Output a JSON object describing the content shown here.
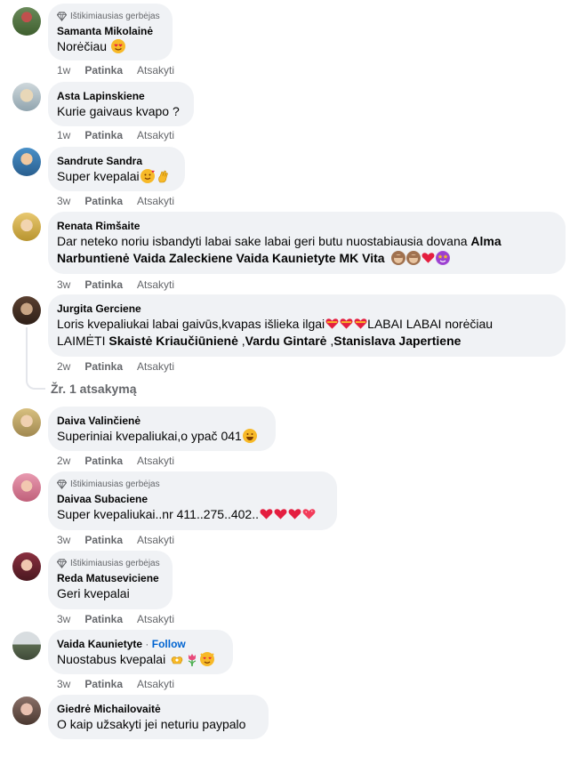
{
  "badge_label": "Ištikimiausias gerbėjas",
  "actions": {
    "like": "Patinka",
    "reply": "Atsakyti"
  },
  "follow_label": "Follow",
  "comments": [
    {
      "author": "Samanta Mikolainė",
      "text": "Norėčiau",
      "time": "1w",
      "badge": true
    },
    {
      "author": "Asta Lapinskiene",
      "text": "Kurie gaivaus kvapo ?",
      "time": "1w"
    },
    {
      "author": "Sandrute Sandra",
      "text": "Super kvepalai",
      "time": "3w"
    },
    {
      "author": "Renata Rimšaite",
      "text_line1": "Dar neteko noriu isbandyti labai sake labai geri butu nuostabiausia dovana",
      "tag1": "Alma",
      "tag2": "Narbuntienė",
      "tag3": "Vaida Zaleckiene",
      "tag4": "Vaida Kaunietyte",
      "tag5": "MK Vita",
      "time": "3w"
    },
    {
      "author": "Jurgita Gerciene",
      "text_line1": "Loris kvepaliukai labai gaivūs,kvapas išlieka ilgai",
      "text_line1_end": "LABAI LABAI norėčiau",
      "text_line2": "LAIMĖTI",
      "tag1": "Skaistė Kriaučiūnienė",
      "sep1": " ,",
      "tag2": "Vardu Gintarė",
      "sep2": " ,",
      "tag3": "Stanislava Japertiene",
      "time": "2w",
      "replies": "Žr. 1 atsakymą"
    },
    {
      "author": "Daiva Valinčienė",
      "text": "Superiniai kvepaliukai,o ypač 041",
      "time": "2w"
    },
    {
      "author": "Daivaa Subaciene",
      "text": "Super kvepaliukai..nr 411..275..402..",
      "time": "3w",
      "badge": true
    },
    {
      "author": "Reda Matuseviciene",
      "text": "Geri kvepalai",
      "time": "3w",
      "badge": true
    },
    {
      "author": "Vaida Kaunietyte",
      "text": "Nuostabus kvepalai",
      "time": "3w"
    },
    {
      "author": "Giedrė Michailovaitė",
      "text": "O kaip užsakyti jei neturiu paypalo"
    }
  ],
  "colors": {
    "bubble": "#f0f2f5",
    "secondary_text": "#65676b",
    "follow": "#0064d1",
    "heart": "#e41e3f",
    "emoji_yellow": "#f7b928"
  }
}
